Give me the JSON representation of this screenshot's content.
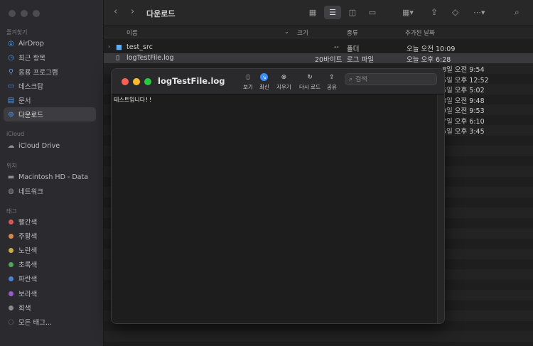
{
  "sidebar": {
    "sections": [
      {
        "title": "즐겨찾기",
        "items": [
          {
            "label": "AirDrop",
            "icon": "airdrop-icon"
          },
          {
            "label": "최근 항목",
            "icon": "clock-icon"
          },
          {
            "label": "응용 프로그램",
            "icon": "apps-icon"
          },
          {
            "label": "데스크탑",
            "icon": "desktop-icon"
          },
          {
            "label": "문서",
            "icon": "document-icon"
          },
          {
            "label": "다운로드",
            "icon": "download-icon",
            "active": true
          }
        ]
      },
      {
        "title": "iCloud",
        "items": [
          {
            "label": "iCloud Drive",
            "icon": "cloud-icon"
          }
        ]
      },
      {
        "title": "위치",
        "items": [
          {
            "label": "Macintosh HD - Data",
            "icon": "disk-icon"
          },
          {
            "label": "네트워크",
            "icon": "network-icon"
          }
        ]
      },
      {
        "title": "태그",
        "items": [
          {
            "label": "빨간색",
            "color": "#d45a5a"
          },
          {
            "label": "주황색",
            "color": "#d4894a"
          },
          {
            "label": "노란색",
            "color": "#c9ad4a"
          },
          {
            "label": "초록색",
            "color": "#4fa95a"
          },
          {
            "label": "파란색",
            "color": "#4a7fd4"
          },
          {
            "label": "보라색",
            "color": "#9a5ac9"
          },
          {
            "label": "회색",
            "color": "#8a8a8d"
          },
          {
            "label": "모든 태그...",
            "icon": "tags-icon"
          }
        ]
      }
    ]
  },
  "toolbar": {
    "title": "다운로드"
  },
  "columns": {
    "name": "이름",
    "size": "크기",
    "kind": "종류",
    "date": "추가된 날짜"
  },
  "rows": [
    {
      "name": "test_src",
      "size": "--",
      "kind": "폴더",
      "date": "오늘 오전 10:09",
      "folder": true
    },
    {
      "name": "logTestFile.log",
      "size": "20바이트",
      "kind": "로그 파일",
      "date": "오늘 오후 6:28",
      "folder": false,
      "selected": true
    },
    {
      "date": "8일 오전 9:54"
    },
    {
      "date": "5일 오후 12:52"
    },
    {
      "date": "5일 오후 5:02"
    },
    {
      "date": "8일 오전 9:48"
    },
    {
      "date": "9일 오전 9:53"
    },
    {
      "date": "7일 오후 6:10"
    },
    {
      "date": "5일 오후 3:45"
    }
  ],
  "logwindow": {
    "title": "logTestFile.log",
    "buttons": {
      "view": "보기",
      "recent": "최신",
      "clear": "지우기",
      "reload": "다시 로드",
      "share": "공유"
    },
    "search_placeholder": "검색",
    "content": "테스트입니다!!"
  },
  "colors": {
    "red": "#ff5f57",
    "yellow": "#febc2e",
    "green": "#28c840",
    "accent": "#3f8ef5"
  }
}
